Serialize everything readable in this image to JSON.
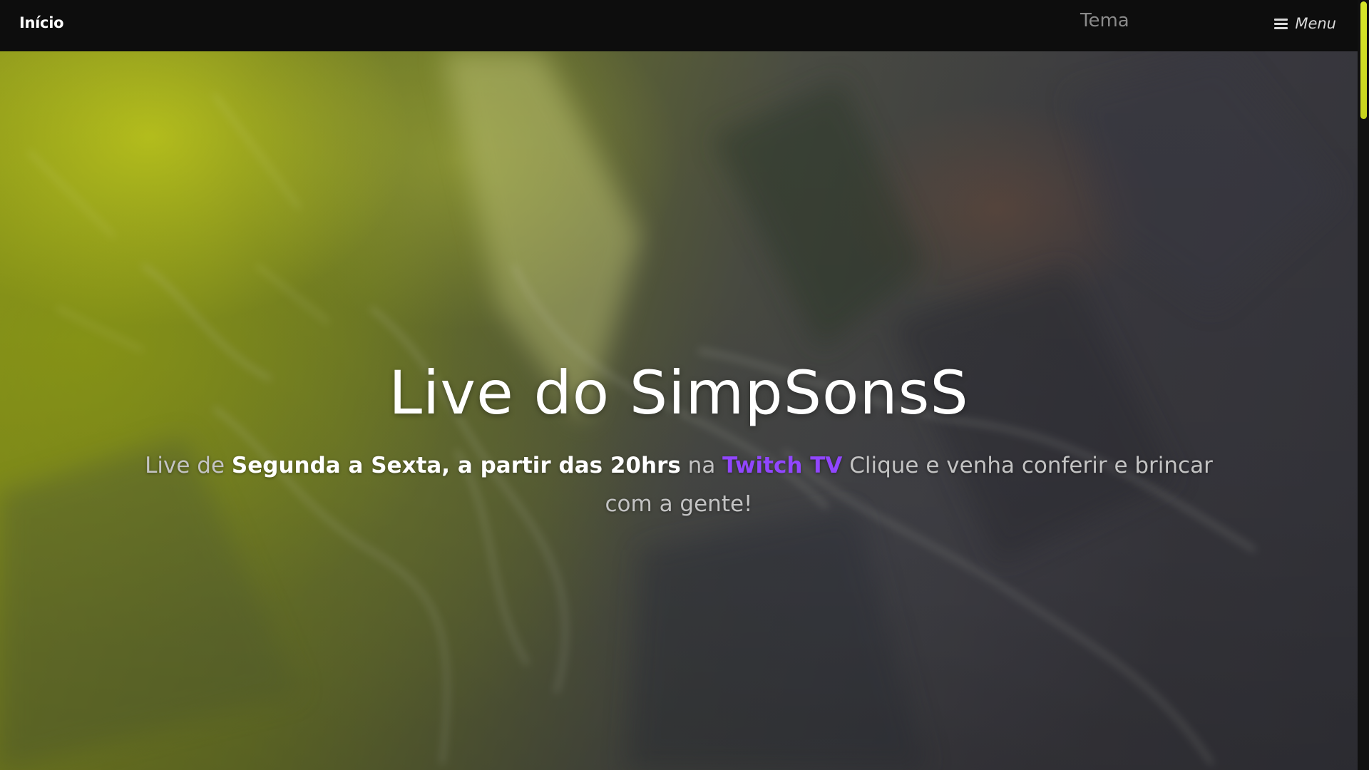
{
  "navbar": {
    "home_label": "Início",
    "theme_label": "Tema",
    "menu_label": "Menu",
    "menu_icon": "hamburger-icon"
  },
  "hero": {
    "title": "Live do SimpSonsS",
    "subtitle": {
      "part1": "Live de ",
      "highlight": "Segunda a Sexta, a partir das 20hrs",
      "part2": " na ",
      "link": "Twitch TV",
      "part3": " Clique e venha conferir e brincar com a gente!"
    }
  },
  "colors": {
    "navbar_bg": "#0d0d0d",
    "link_accent": "#9146ff",
    "scroll_thumb": "#d7e62a",
    "hero_tint_left": "#8f9a1f",
    "hero_tint_right": "#36363d"
  }
}
